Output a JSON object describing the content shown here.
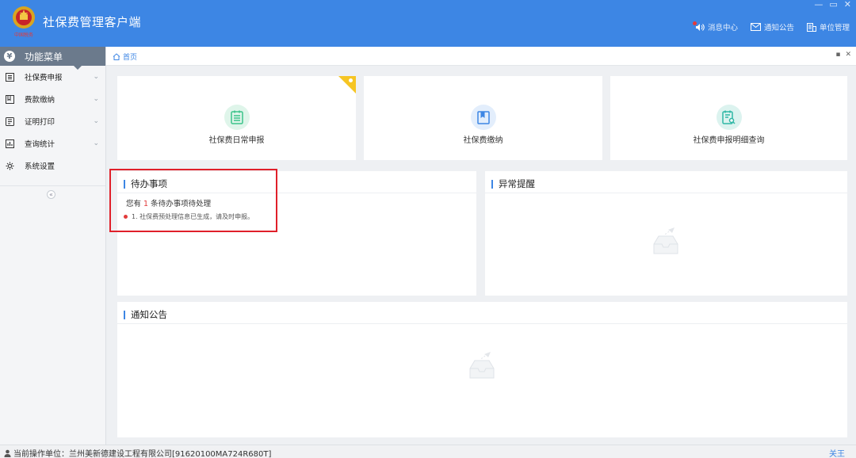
{
  "header": {
    "app_title": "社保费管理客户端",
    "window_controls": {
      "minimize": "—",
      "restore": "▭",
      "close": "✕"
    },
    "nav": [
      {
        "label": "消息中心",
        "icon": "bell-icon"
      },
      {
        "label": "通知公告",
        "icon": "mail-icon"
      },
      {
        "label": "单位管理",
        "icon": "building-icon"
      }
    ]
  },
  "sidebar": {
    "title": "功能菜单",
    "items": [
      {
        "label": "社保费申报",
        "icon": "form-icon",
        "has_children": true
      },
      {
        "label": "费款缴纳",
        "icon": "book-icon",
        "has_children": true
      },
      {
        "label": "证明打印",
        "icon": "print-icon",
        "has_children": true
      },
      {
        "label": "查询统计",
        "icon": "chart-icon",
        "has_children": true
      },
      {
        "label": "系统设置",
        "icon": "gear-icon",
        "has_children": false
      }
    ],
    "collapse_symbol": "«"
  },
  "tabbar": {
    "home_label": "首页"
  },
  "shortcuts": [
    {
      "label": "社保费日常申报",
      "icon": "doc-list-icon",
      "color": "#3cc48a"
    },
    {
      "label": "社保费缴纳",
      "icon": "bookmark-icon",
      "color": "#3d86e4"
    },
    {
      "label": "社保费申报明细查询",
      "icon": "doc-search-icon",
      "color": "#2fb7a5"
    }
  ],
  "todo": {
    "title": "待办事项",
    "summary_prefix": "您有",
    "count": "1",
    "summary_suffix": "条待办事项待处理",
    "items": [
      "1. 社保费预处理信息已生成，请及时申报。"
    ]
  },
  "alerts": {
    "title": "异常提醒"
  },
  "notices": {
    "title": "通知公告"
  },
  "statusbar": {
    "unit_label": "当前操作单位：兰州美新德建设工程有限公司[91620100MA724R680T]",
    "close_label": "关王"
  },
  "colors": {
    "brand": "#3d86e4",
    "highlight": "#e0202a",
    "badge": "#f6c523"
  }
}
